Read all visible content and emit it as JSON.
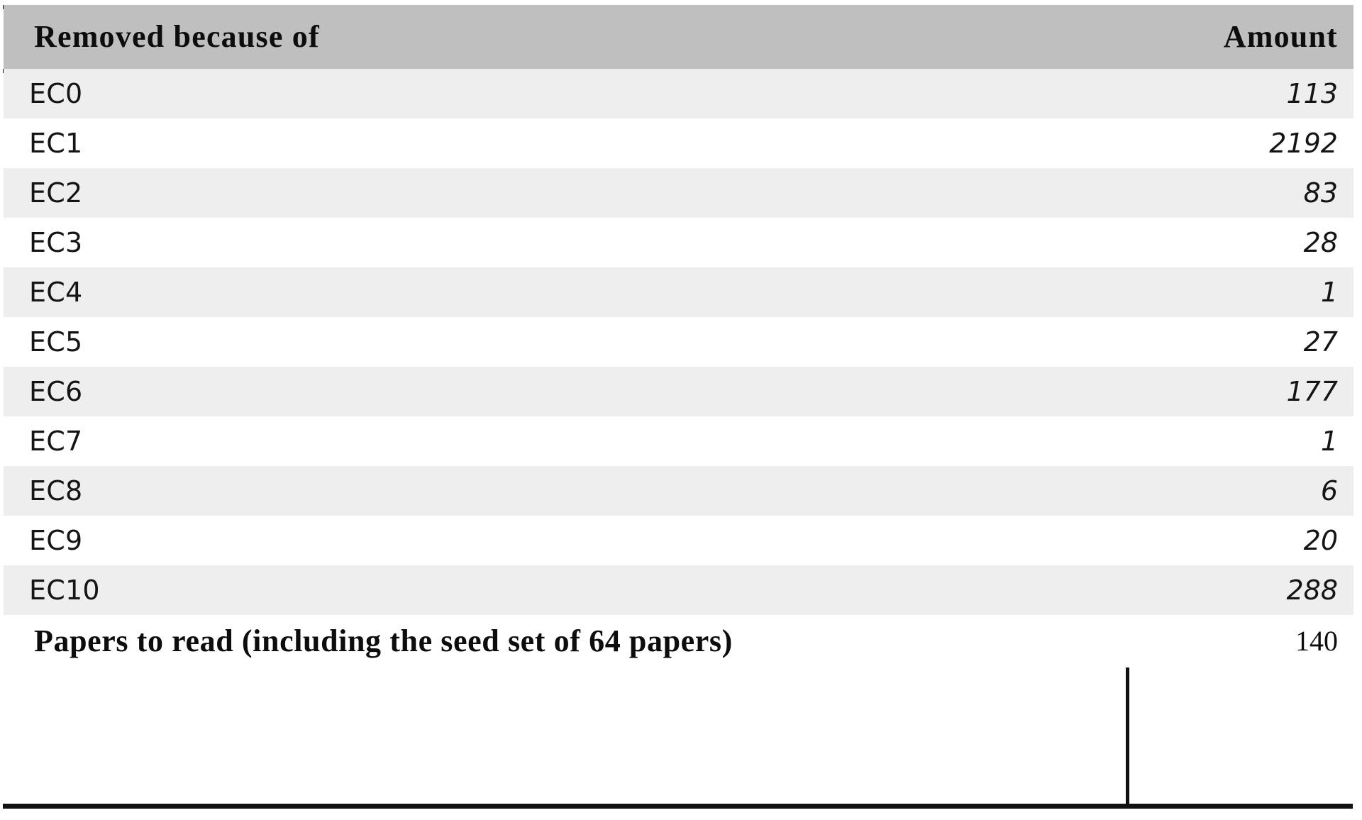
{
  "table": {
    "columns": [
      {
        "key": "label",
        "header": "Removed because of",
        "align": "left"
      },
      {
        "key": "amount",
        "header": "Amount",
        "align": "right"
      }
    ],
    "rows": [
      {
        "label": "EC0",
        "amount": "113"
      },
      {
        "label": "EC1",
        "amount": "2192"
      },
      {
        "label": "EC2",
        "amount": "83"
      },
      {
        "label": "EC3",
        "amount": "28"
      },
      {
        "label": "EC4",
        "amount": "1"
      },
      {
        "label": "EC5",
        "amount": "27"
      },
      {
        "label": "EC6",
        "amount": "177"
      },
      {
        "label": "EC7",
        "amount": "1"
      },
      {
        "label": "EC8",
        "amount": "6"
      },
      {
        "label": "EC9",
        "amount": "20"
      },
      {
        "label": "EC10",
        "amount": "288"
      }
    ],
    "summary_row": {
      "label": "Papers to read (including the seed set of 64 papers)",
      "amount": "140"
    },
    "style": {
      "header_background": "#bfbfbf",
      "stripe_background": "#eeeeee",
      "plain_background": "#ffffff",
      "rule_color": "#111111",
      "text_color": "#141414"
    }
  }
}
